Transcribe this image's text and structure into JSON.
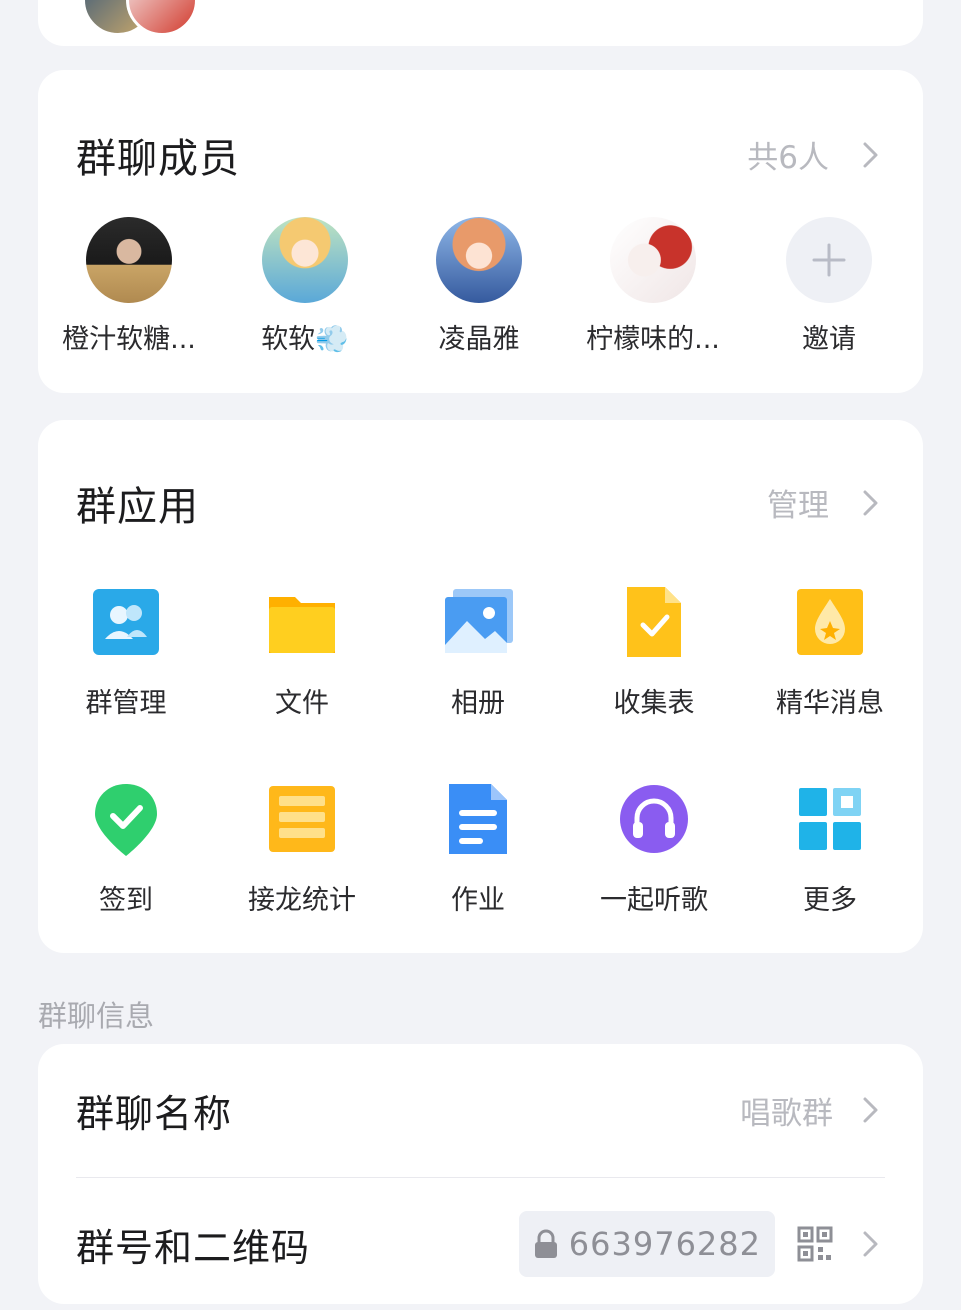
{
  "members_section": {
    "title": "群聊成员",
    "count_label": "共6人",
    "members": [
      {
        "name": "橙汁软糖..."
      },
      {
        "name": "软软💨"
      },
      {
        "name": "凌晶雅"
      },
      {
        "name": "柠檬味的..."
      }
    ],
    "invite_label": "邀请"
  },
  "apps_section": {
    "title": "群应用",
    "manage_label": "管理",
    "apps": [
      {
        "label": "群管理",
        "icon": "group-manage-icon"
      },
      {
        "label": "文件",
        "icon": "folder-icon"
      },
      {
        "label": "相册",
        "icon": "photo-album-icon"
      },
      {
        "label": "收集表",
        "icon": "form-check-icon"
      },
      {
        "label": "精华消息",
        "icon": "essence-drop-icon"
      },
      {
        "label": "签到",
        "icon": "check-in-pin-icon"
      },
      {
        "label": "接龙统计",
        "icon": "list-chain-icon"
      },
      {
        "label": "作业",
        "icon": "homework-doc-icon"
      },
      {
        "label": "一起听歌",
        "icon": "headphones-icon"
      },
      {
        "label": "更多",
        "icon": "grid-more-icon"
      }
    ]
  },
  "info_section": {
    "label": "群聊信息",
    "rows": {
      "name": {
        "title": "群聊名称",
        "value": "唱歌群"
      },
      "number": {
        "title": "群号和二维码",
        "value": "663976282"
      }
    }
  },
  "colors": {
    "background": "#f2f3f7",
    "card": "#ffffff",
    "muted_text": "#b8b9bf",
    "accent_blue": "#3a8ef6",
    "accent_yellow": "#ffc21a",
    "accent_green": "#2fcf6e",
    "accent_purple": "#8a5cf0"
  }
}
